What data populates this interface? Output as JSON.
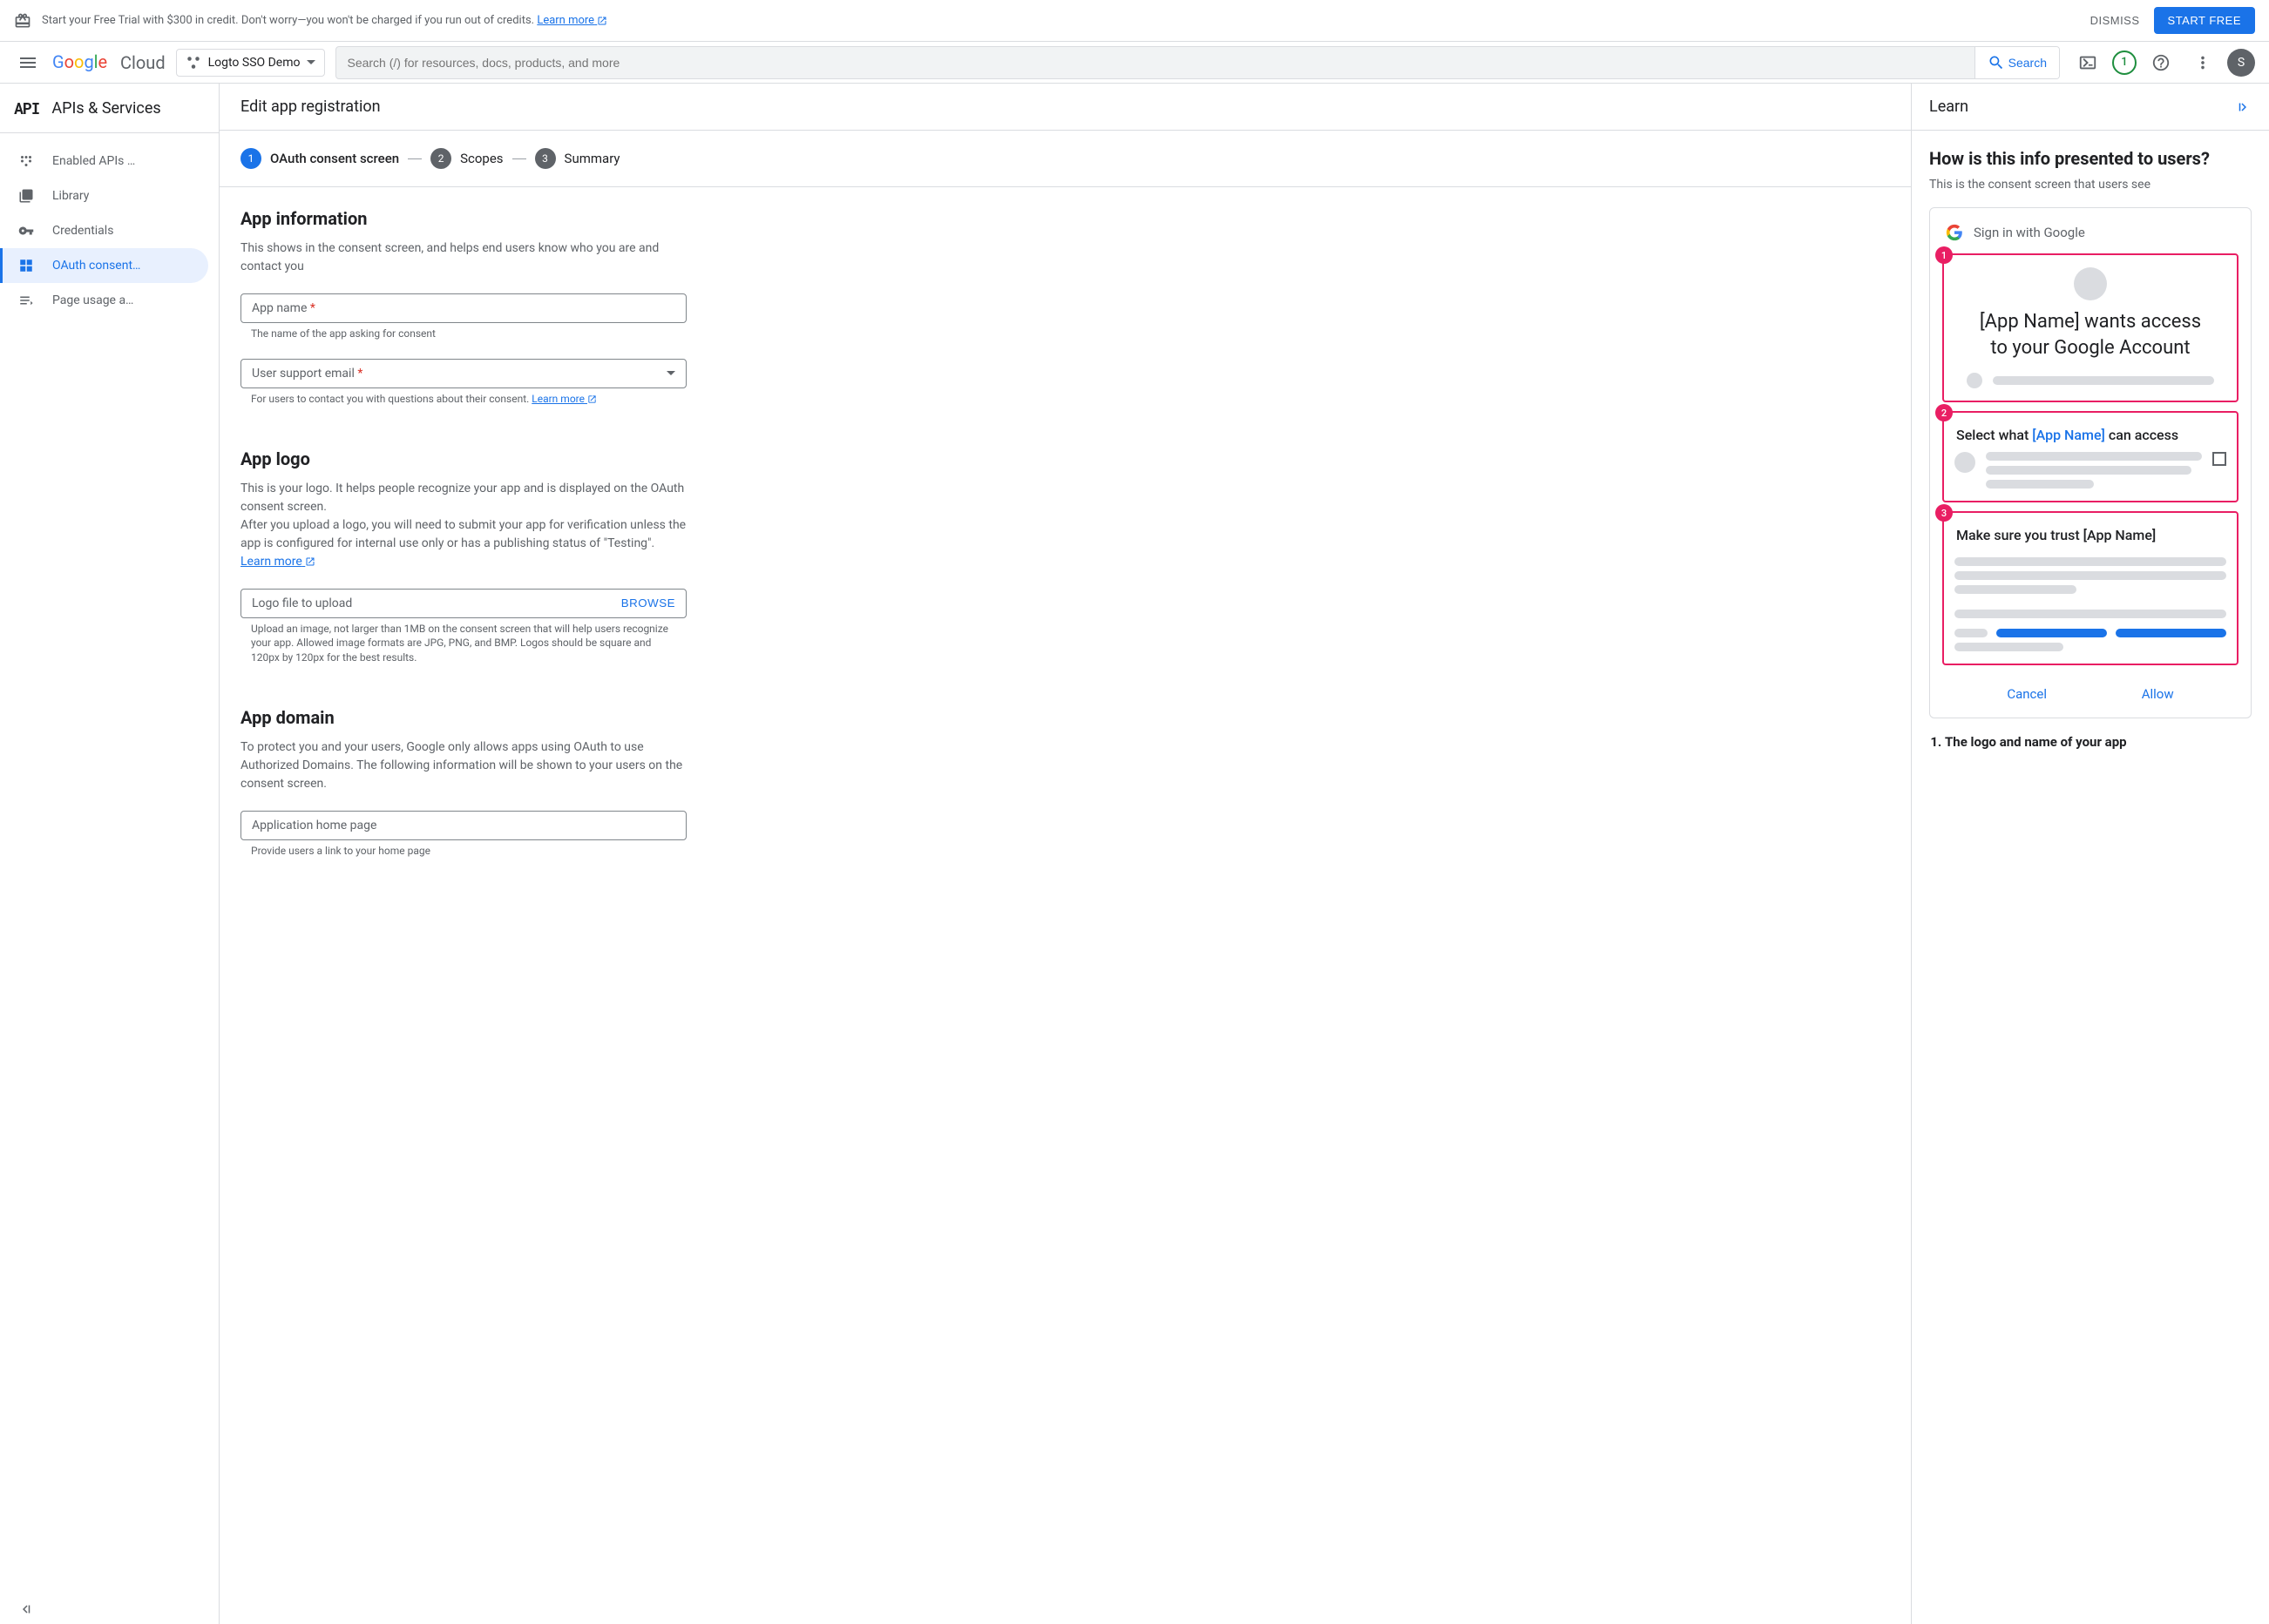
{
  "banner": {
    "text": "Start your Free Trial with $300 in credit. Don't worry—you won't be charged if you run out of credits. ",
    "learn_more": "Learn more",
    "dismiss": "DISMISS",
    "start_free": "START FREE"
  },
  "header": {
    "logo_cloud": "Cloud",
    "project": "Logto SSO Demo",
    "search_placeholder": "Search (/) for resources, docs, products, and more",
    "search_label": "Search",
    "trial_badge": "1",
    "avatar": "S"
  },
  "sidebar": {
    "title": "APIs & Services",
    "items": [
      {
        "label": "Enabled APIs …"
      },
      {
        "label": "Library"
      },
      {
        "label": "Credentials"
      },
      {
        "label": "OAuth consent…"
      },
      {
        "label": "Page usage a…"
      }
    ]
  },
  "content": {
    "title": "Edit app registration",
    "steps": [
      {
        "num": "1",
        "label": "OAuth consent screen"
      },
      {
        "num": "2",
        "label": "Scopes"
      },
      {
        "num": "3",
        "label": "Summary"
      }
    ],
    "app_info": {
      "title": "App information",
      "desc": "This shows in the consent screen, and helps end users know who you are and contact you",
      "app_name_label": "App name",
      "app_name_hint": "The name of the app asking for consent",
      "email_label": "User support email",
      "email_hint": "For users to contact you with questions about their consent. ",
      "learn_more": "Learn more"
    },
    "app_logo": {
      "title": "App logo",
      "desc1": "This is your logo. It helps people recognize your app and is displayed on the OAuth consent screen.",
      "desc2": "After you upload a logo, you will need to submit your app for verification unless the app is configured for internal use only or has a publishing status of \"Testing\". ",
      "learn_more": "Learn more",
      "upload_label": "Logo file to upload",
      "browse": "BROWSE",
      "upload_hint": "Upload an image, not larger than 1MB on the consent screen that will help users recognize your app. Allowed image formats are JPG, PNG, and BMP. Logos should be square and 120px by 120px for the best results."
    },
    "app_domain": {
      "title": "App domain",
      "desc": "To protect you and your users, Google only allows apps using OAuth to use Authorized Domains. The following information will be shown to your users on the consent screen.",
      "homepage_label": "Application home page",
      "homepage_hint": "Provide users a link to your home page"
    }
  },
  "learn": {
    "title": "Learn",
    "heading": "How is this info presented to users?",
    "desc": "This is the consent screen that users see",
    "signin": "Sign in with Google",
    "pv1_line1": "[App Name] wants access",
    "pv1_line2": "to your Google Account",
    "pv2_prefix": "Select what ",
    "pv2_app": "[App Name]",
    "pv2_suffix": " can access",
    "pv3": "Make sure you trust [App Name]",
    "cancel": "Cancel",
    "allow": "Allow",
    "list_item1": "The logo and name of your app"
  }
}
